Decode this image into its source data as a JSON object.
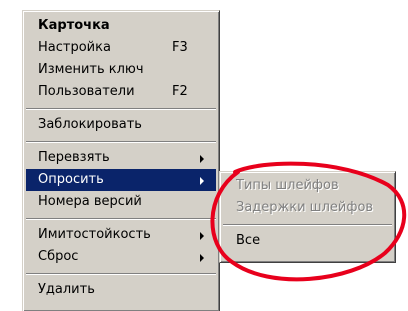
{
  "main_menu": {
    "items": [
      {
        "label": "Карточка",
        "shortcut": ""
      },
      {
        "label": "Настройка",
        "shortcut": "F3"
      },
      {
        "label": "Изменить ключ",
        "shortcut": ""
      },
      {
        "label": "Пользователи",
        "shortcut": "F2"
      },
      {
        "label": "Заблокировать",
        "shortcut": ""
      },
      {
        "label": "Перевзять",
        "shortcut": ""
      },
      {
        "label": "Опросить",
        "shortcut": ""
      },
      {
        "label": "Номера версий",
        "shortcut": ""
      },
      {
        "label": "Имитостойкость",
        "shortcut": ""
      },
      {
        "label": "Сброс",
        "shortcut": ""
      },
      {
        "label": "Удалить",
        "shortcut": ""
      }
    ]
  },
  "sub_menu": {
    "items": [
      {
        "label": "Типы шлейфов",
        "enabled": false
      },
      {
        "label": "Задержки шлейфов",
        "enabled": false
      },
      {
        "label": "Все",
        "enabled": true
      }
    ]
  },
  "colors": {
    "menu_face": "#d4d0c8",
    "highlight": "#0a246a",
    "disabled_text": "#808080",
    "annotation": "#e8001c"
  }
}
